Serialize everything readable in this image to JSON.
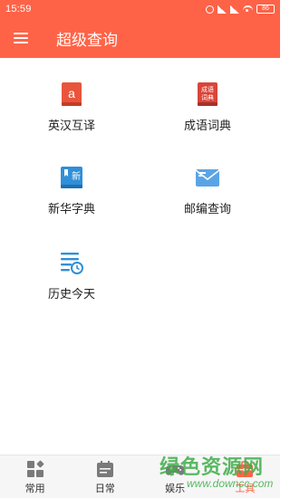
{
  "status_bar": {
    "time": "15:59",
    "battery": "86"
  },
  "app_bar": {
    "title": "超级查询",
    "menu_icon": "hamburger-menu-icon"
  },
  "tools": [
    {
      "label": "英汉互译",
      "icon": "dictionary-a-icon",
      "icon_text": "a"
    },
    {
      "label": "成语词典",
      "icon": "idiom-book-icon",
      "icon_text": "成语词典"
    },
    {
      "label": "新华字典",
      "icon": "xinhua-book-icon",
      "icon_text": "新"
    },
    {
      "label": "邮编查询",
      "icon": "envelope-icon"
    },
    {
      "label": "历史今天",
      "icon": "history-list-clock-icon"
    }
  ],
  "bottom_nav": [
    {
      "label": "常用",
      "icon": "grid-shapes-icon",
      "active": false
    },
    {
      "label": "日常",
      "icon": "calendar-icon",
      "active": false
    },
    {
      "label": "娱乐",
      "icon": "gamepad-icon",
      "active": false
    },
    {
      "label": "工具",
      "icon": "toolbox-icon",
      "active": true
    }
  ],
  "watermark": {
    "main": "绿色资源网",
    "sub": "www.downcc.com"
  },
  "colors": {
    "primary": "#ff6347",
    "icon_blue": "#2f8fd8",
    "icon_red": "#e8553c",
    "watermark": "#3fae49"
  }
}
